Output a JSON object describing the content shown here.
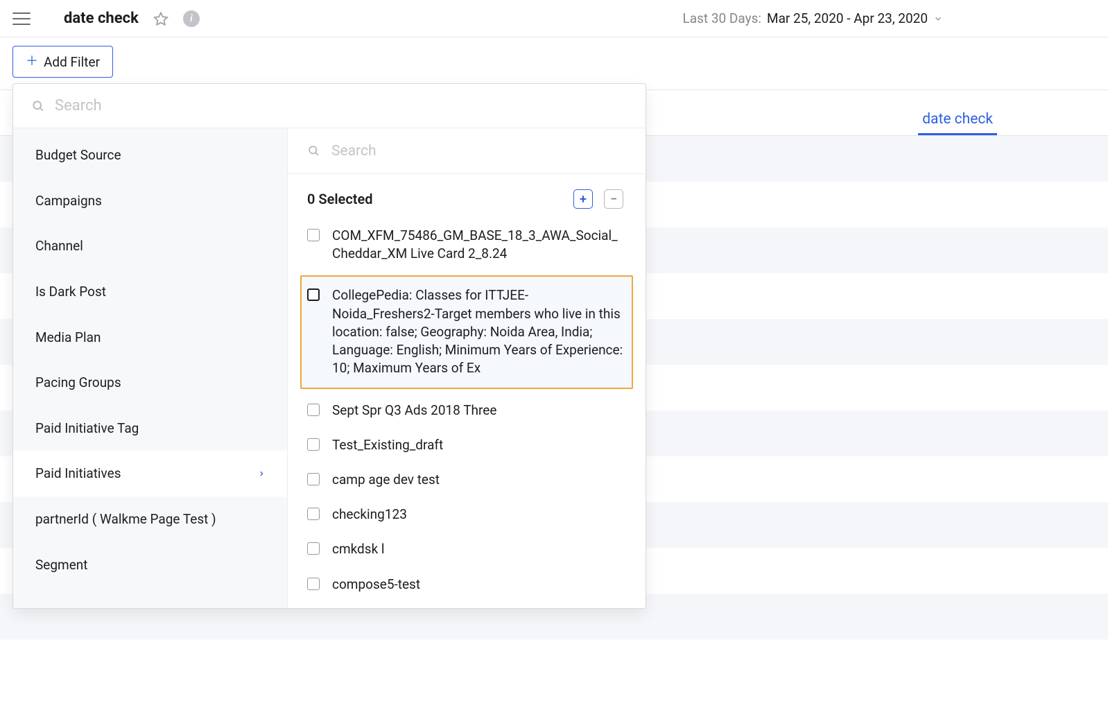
{
  "header": {
    "title": "date check",
    "daterange_label": "Last 30 Days:",
    "daterange_value": "Mar 25, 2020 - Apr 23, 2020"
  },
  "filterbar": {
    "add_filter_label": "Add Filter"
  },
  "tabs": {
    "active_label": "date check"
  },
  "popover": {
    "outer_search_placeholder": "Search",
    "inner_search_placeholder": "Search",
    "selected_count_label": "0 Selected",
    "categories": [
      {
        "label": "Budget Source",
        "active": false
      },
      {
        "label": "Campaigns",
        "active": false
      },
      {
        "label": "Channel",
        "active": false
      },
      {
        "label": "Is Dark Post",
        "active": false
      },
      {
        "label": "Media Plan",
        "active": false
      },
      {
        "label": "Pacing Groups",
        "active": false
      },
      {
        "label": "Paid Initiative Tag",
        "active": false
      },
      {
        "label": "Paid Initiatives",
        "active": true
      },
      {
        "label": "partnerId ( Walkme Page Test )",
        "active": false
      },
      {
        "label": "Segment",
        "active": false
      }
    ],
    "values": [
      {
        "label": "COM_XFM_75486_GM_BASE_18_3_AWA_Social_Cheddar_XM Live Card 2_8.24",
        "highlight": false
      },
      {
        "label": "CollegePedia: Classes for ITTJEE-Noida_Freshers2-Target members who live in this location: false; Geography: Noida Area, India; Language: English; Minimum Years of Experience: 10; Maximum Years of Ex",
        "highlight": true
      },
      {
        "label": "Sept Spr Q3 Ads 2018 Three",
        "highlight": false
      },
      {
        "label": "Test_Existing_draft",
        "highlight": false
      },
      {
        "label": "camp age dev test",
        "highlight": false
      },
      {
        "label": "checking123",
        "highlight": false
      },
      {
        "label": "cmkdsk l",
        "highlight": false
      },
      {
        "label": "compose5-test",
        "highlight": false
      }
    ]
  }
}
